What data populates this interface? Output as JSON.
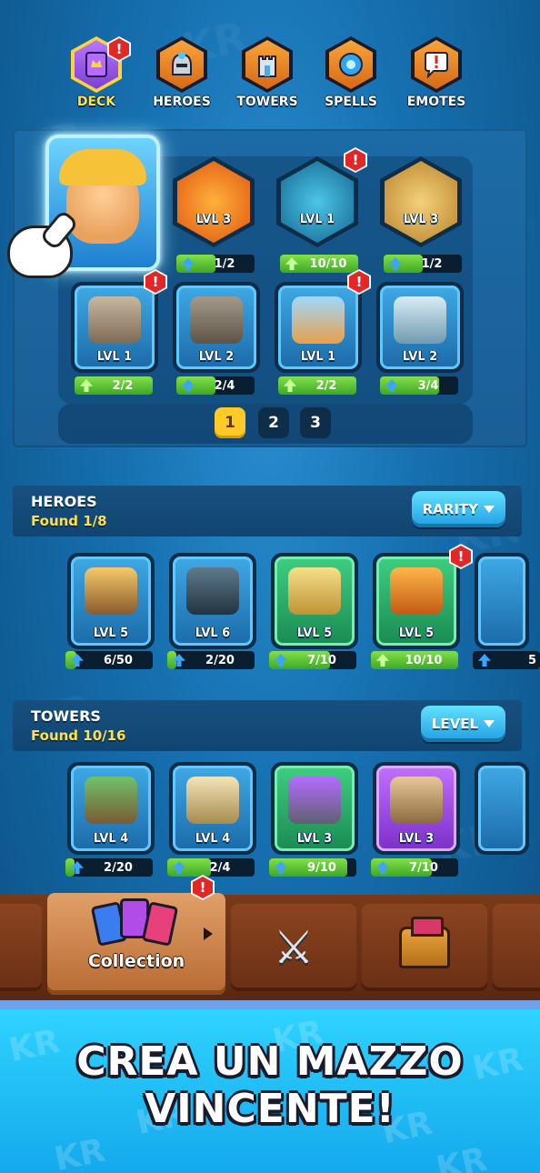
{
  "tabs": [
    {
      "label": "DECK",
      "icon": "deck-icon",
      "active": true,
      "alert": true
    },
    {
      "label": "HEROES",
      "icon": "helmet-icon",
      "active": false,
      "alert": false
    },
    {
      "label": "TOWERS",
      "icon": "tower-icon",
      "active": false,
      "alert": false
    },
    {
      "label": "SPELLS",
      "icon": "spell-orb-icon",
      "active": false,
      "alert": false
    },
    {
      "label": "EMOTES",
      "icon": "emote-icon",
      "active": false,
      "alert": false
    }
  ],
  "alert_mark": "!",
  "deck": {
    "spells": [
      {
        "level": "LVL 3",
        "progress": "1/2",
        "fraction": 0.5,
        "color": "#f08a1a"
      },
      {
        "level": "LVL 1",
        "progress": "10/10",
        "fraction": 1.0,
        "color": "#1e8cbf",
        "alert": true
      },
      {
        "level": "LVL 3",
        "progress": "1/2",
        "fraction": 0.5,
        "color": "#e0b24a"
      }
    ],
    "towers": [
      {
        "level": "LVL 1",
        "progress": "2/2",
        "fraction": 1.0,
        "alert": true
      },
      {
        "level": "LVL 2",
        "progress": "2/4",
        "fraction": 0.5
      },
      {
        "level": "LVL 1",
        "progress": "2/2",
        "fraction": 1.0,
        "alert": true
      },
      {
        "level": "LVL 2",
        "progress": "3/4",
        "fraction": 0.75
      }
    ],
    "pages": [
      "1",
      "2",
      "3"
    ],
    "active_page": "1"
  },
  "heroes_section": {
    "title": "HEROES",
    "found": "Found 1/8",
    "sort_label": "RARITY",
    "cards": [
      {
        "level": "LVL 5",
        "progress": "6/50",
        "fraction": 0.12,
        "rarity": "blue"
      },
      {
        "level": "LVL 6",
        "progress": "2/20",
        "fraction": 0.1,
        "rarity": "blue"
      },
      {
        "level": "LVL 5",
        "progress": "7/10",
        "fraction": 0.7,
        "rarity": "green"
      },
      {
        "level": "LVL 5",
        "progress": "10/10",
        "fraction": 1.0,
        "rarity": "green",
        "alert": true
      }
    ],
    "partial_progress": "5"
  },
  "towers_section": {
    "title": "TOWERS",
    "found": "Found 10/16",
    "sort_label": "LEVEL",
    "cards": [
      {
        "level": "LVL 4",
        "progress": "2/20",
        "fraction": 0.1,
        "rarity": "blue"
      },
      {
        "level": "LVL 4",
        "progress": "2/4",
        "fraction": 0.5,
        "rarity": "blue"
      },
      {
        "level": "LVL 3",
        "progress": "9/10",
        "fraction": 0.9,
        "rarity": "green"
      },
      {
        "level": "LVL 3",
        "progress": "7/10",
        "fraction": 0.7,
        "rarity": "purple"
      }
    ]
  },
  "bottom_nav": [
    {
      "label": "Collection",
      "icon": "cards-icon",
      "active": true,
      "alert": true
    },
    {
      "label": "",
      "icon": "crossed-swords-icon",
      "active": false
    },
    {
      "label": "",
      "icon": "treasure-chest-icon",
      "active": false
    }
  ],
  "promo": {
    "line1": "CREA UN MAZZO",
    "line2": "VINCENTE!",
    "watermark": "KR"
  }
}
